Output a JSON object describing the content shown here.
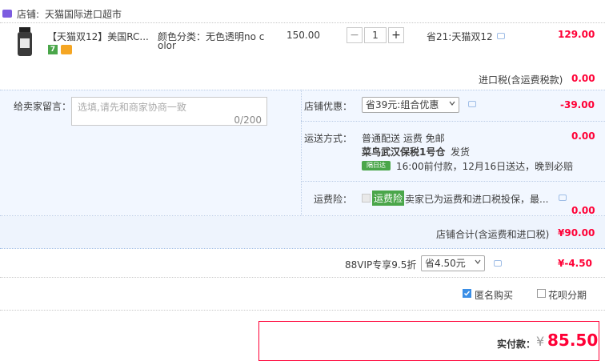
{
  "shop": {
    "label": "店铺:",
    "name": "天猫国际进口超市"
  },
  "item": {
    "title": "【天猫双12】美国RC...",
    "sku_label": "颜色分类：无色透明no c",
    "sku_label_2": "olor",
    "unit_price": "150.00",
    "quantity": "1",
    "discount": "省21:天猫双12",
    "total": "129.00",
    "tag_badge": "7"
  },
  "import_tax": {
    "label": "进口税(含运费税款)",
    "value": "0.00"
  },
  "message": {
    "label": "给卖家留言：",
    "placeholder": "选填,请先和商家协商一致",
    "counter": "0/200"
  },
  "shop_discount": {
    "label": "店铺优惠：",
    "selected": "省39元:组合优惠",
    "value": "-39.00"
  },
  "shipping": {
    "label": "运送方式：",
    "method": "普通配送 运费 免邮",
    "warehouse": "菜鸟武汉保税1号仓",
    "ship_text": "发货",
    "badge": "隔日达",
    "eta": "16:00前付款，12月16日送达，晚到必赔",
    "value": "0.00"
  },
  "shipping_insurance": {
    "label": "运费险：",
    "tag": "运费险",
    "text": "卖家已为运费和进口税投保，最...",
    "value": "0.00"
  },
  "shop_total": {
    "label": "店铺合计(含运费和进口税)",
    "value": "¥90.00"
  },
  "vip": {
    "label": "88VIP专享9.5折",
    "selected": "省4.50元",
    "value": "¥-4.50"
  },
  "options": {
    "anonymous": "匿名购买",
    "huabei": "花呗分期"
  },
  "payment": {
    "label": "实付款：",
    "currency": "¥",
    "amount": "85.50"
  },
  "colors": {
    "accent_red": "#ff0036",
    "band_blue": "#f2f7ff",
    "checkbox_blue": "#3a8ee6",
    "tag_green": "#4aa64a"
  }
}
